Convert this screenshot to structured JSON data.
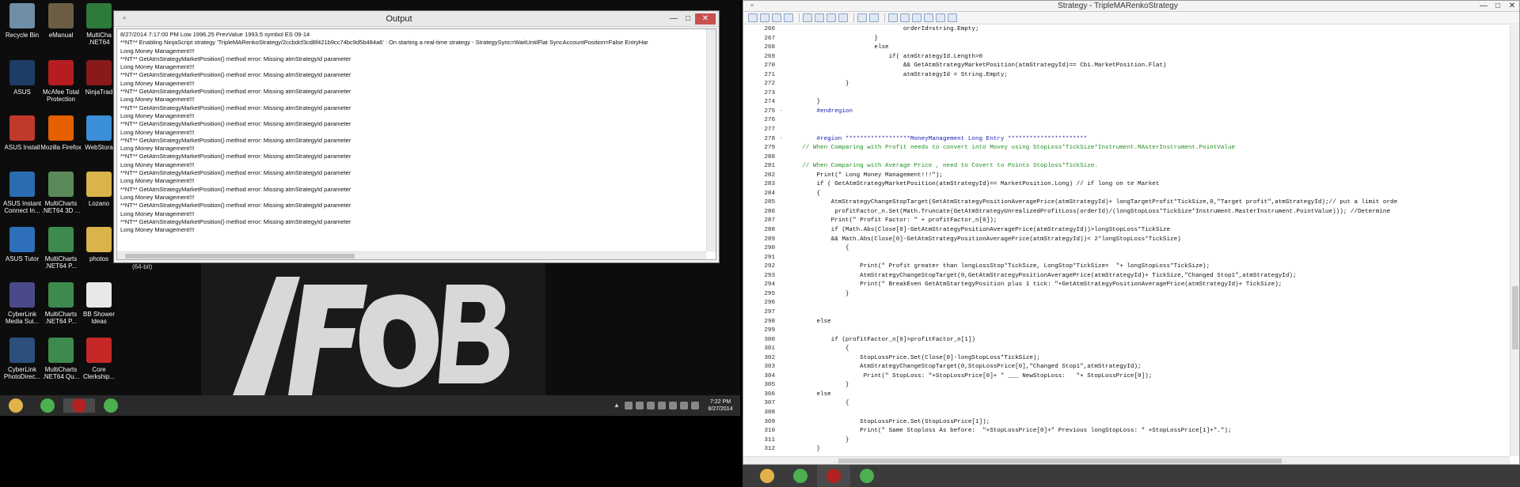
{
  "desktop": {
    "icons": [
      {
        "label": "Recycle Bin",
        "icon": "recycle-bin-icon",
        "color": "#6f8ea8"
      },
      {
        "label": "eManual",
        "icon": "emanual-icon",
        "color": "#6b5e44"
      },
      {
        "label": "MultiCha .NET64",
        "icon": "multicharts-icon",
        "color": "#2d7a3a"
      },
      {
        "label": "ASUS",
        "icon": "asus-icon",
        "color": "#1d3c66"
      },
      {
        "label": "McAfee Total Protection",
        "icon": "mcafee-icon",
        "color": "#b51d20"
      },
      {
        "label": "NinjaTrad",
        "icon": "ninjatrader-icon",
        "color": "#8a1a1a"
      },
      {
        "label": "ASUS Install",
        "icon": "asus-install-icon",
        "color": "#c0392b"
      },
      {
        "label": "Mozilla Firefox",
        "icon": "firefox-icon",
        "color": "#e66000"
      },
      {
        "label": "WebStora",
        "icon": "webstorage-icon",
        "color": "#3b8fd6"
      },
      {
        "label": "ASUS Instant Connect In...",
        "icon": "asus-instant-connect-icon",
        "color": "#2b6cb0"
      },
      {
        "label": "MultiCharts .NET64 3D ...",
        "icon": "multicharts-3d-icon",
        "color": "#5a8a5a"
      },
      {
        "label": "Lozano",
        "icon": "folder-icon",
        "color": "#d9b44a"
      },
      {
        "label": "ASUS Tutor",
        "icon": "asus-tutor-icon",
        "color": "#2d6fb8"
      },
      {
        "label": "MultiCharts .NET64 P...",
        "icon": "multicharts-p-icon",
        "color": "#3d8a4d"
      },
      {
        "label": "photos",
        "icon": "folder-icon",
        "color": "#d9b44a"
      },
      {
        "label": "CyberLink Media Sui...",
        "icon": "cyberlink-icon",
        "color": "#4a4a8a"
      },
      {
        "label": "MultiCharts .NET64 P...",
        "icon": "multicharts-p-icon",
        "color": "#3d8a4d"
      },
      {
        "label": "BB Shower Ideas",
        "icon": "document-icon",
        "color": "#e8e8e8"
      },
      {
        "label": "CyberLink PhotoDirec...",
        "icon": "photodirector-icon",
        "color": "#2c4f7c"
      },
      {
        "label": "MultiCharts .NET64 Qu...",
        "icon": "multicharts-q-icon",
        "color": "#3d8a4d"
      },
      {
        "label": "Core Clerkship...",
        "icon": "pdf-icon",
        "color": "#c62828"
      }
    ],
    "bit_label": "(64-bit)"
  },
  "output_window": {
    "title": "Output",
    "lines": [
      "8/27/2014 7:17:00 PM Low 1996.25 PrevValue 1993.5 symbol ES 09-14",
      "**NT** Enabling NinjaScript strategy 'TripleMARenkoStrategy/2ccbdcf3cd8f421b9cc74bc9d5b484a6' : On starting a real-time strategy - StrategySync=WaitUntilFlat SyncAccountPosition=False EntryHar",
      "Long Money Management!!!",
      "**NT** GetAtmStrategyMarketPosition() method error: Missing atmStrategyId parameter",
      "Long Money Management!!!",
      "**NT** GetAtmStrategyMarketPosition() method error: Missing atmStrategyId parameter",
      "Long Money Management!!!",
      "**NT** GetAtmStrategyMarketPosition() method error: Missing atmStrategyId parameter",
      "Long Money Management!!!",
      "**NT** GetAtmStrategyMarketPosition() method error: Missing atmStrategyId parameter",
      "Long Money Management!!!",
      "**NT** GetAtmStrategyMarketPosition() method error: Missing atmStrategyId parameter",
      "Long Money Management!!!",
      "**NT** GetAtmStrategyMarketPosition() method error: Missing atmStrategyId parameter",
      "Long Money Management!!!",
      "**NT** GetAtmStrategyMarketPosition() method error: Missing atmStrategyId parameter",
      "Long Money Management!!!",
      "**NT** GetAtmStrategyMarketPosition() method error: Missing atmStrategyId parameter",
      "Long Money Management!!!",
      "**NT** GetAtmStrategyMarketPosition() method error: Missing atmStrategyId parameter",
      "Long Money Management!!!",
      "**NT** GetAtmStrategyMarketPosition() method error: Missing atmStrategyId parameter",
      "Long Money Management!!!",
      "**NT** GetAtmStrategyMarketPosition() method error: Missing atmStrategyId parameter",
      "Long Money Management!!!"
    ]
  },
  "left_taskbar": {
    "apps": [
      {
        "icon": "file-explorer-icon",
        "color": "#e0b34a",
        "active": false
      },
      {
        "icon": "chrome-icon",
        "color": "#4caf50",
        "active": false
      },
      {
        "icon": "ninjatrader-icon",
        "color": "#b22222",
        "active": true
      },
      {
        "icon": "chrome-icon",
        "color": "#4caf50",
        "active": false
      }
    ],
    "time": "7:22 PM",
    "date": "8/27/2014"
  },
  "editor": {
    "title": "Strategy - TripleMARenkoStrategy",
    "lines": [
      {
        "n": "266",
        "fold": "",
        "text": "                                orderId=string.Empty;",
        "kind": "code"
      },
      {
        "n": "267",
        "fold": "",
        "text": "                        }",
        "kind": "code"
      },
      {
        "n": "268",
        "fold": "",
        "text": "                        else",
        "kind": "code"
      },
      {
        "n": "269",
        "fold": "",
        "text": "                            if( atmStrategyId.Length>0",
        "kind": "code"
      },
      {
        "n": "270",
        "fold": "",
        "text": "                                && GetAtmStrategyMarketPosition(atmStrategyId)== Cbi.MarketPosition.Flat)",
        "kind": "code"
      },
      {
        "n": "271",
        "fold": "",
        "text": "                                atmStrategyId = String.Empty;",
        "kind": "code"
      },
      {
        "n": "272",
        "fold": "",
        "text": "                }",
        "kind": "code"
      },
      {
        "n": "273",
        "fold": "",
        "text": "",
        "kind": "code"
      },
      {
        "n": "274",
        "fold": "",
        "text": "        }",
        "kind": "code"
      },
      {
        "n": "275",
        "fold": "-",
        "text": "        #endregion",
        "kind": "region"
      },
      {
        "n": "276",
        "fold": "",
        "text": "",
        "kind": "code"
      },
      {
        "n": "277",
        "fold": "",
        "text": "",
        "kind": "code"
      },
      {
        "n": "278",
        "fold": "-",
        "text": "        #region ******************MoneyManagement Long Entry **********************",
        "kind": "region"
      },
      {
        "n": "279",
        "fold": "",
        "text": "    // When Comparing with Profit needs to convert into Movey using StopLoss*TickSize*Instrument.MAsterInstrument.PointValue",
        "kind": "comment"
      },
      {
        "n": "280",
        "fold": "",
        "text": "",
        "kind": "code"
      },
      {
        "n": "281",
        "fold": "",
        "text": "    // When Comparing with Average Price , need to Covert to Points Stoploss*TickSize.",
        "kind": "comment"
      },
      {
        "n": "282",
        "fold": "",
        "text": "        Print(\" Long Money Management!!!\");",
        "kind": "code"
      },
      {
        "n": "283",
        "fold": "",
        "text": "        if ( GetAtmStrategyMarketPosition(atmStrategyId)== MarketPosition.Long) // if long on te Market",
        "kind": "code"
      },
      {
        "n": "284",
        "fold": "",
        "text": "        {",
        "kind": "code"
      },
      {
        "n": "285",
        "fold": "",
        "text": "            AtmStrategyChangeStopTarget(GetAtmStrategyPositionAveragePrice(atmStrategyId)+ longTargetProfit*TickSize,0,\"Target profit\",atmStrategyId);// put a limit orde",
        "kind": "code"
      },
      {
        "n": "286",
        "fold": "",
        "text": "             profitFactor_n.Set(Math.Truncate(GetAtmStrategyUnrealizedProfitLoss(orderId)/(longStopLoss*TickSize*Instrument.MasterInstrument.PointValue))); //Determine",
        "kind": "code"
      },
      {
        "n": "287",
        "fold": "",
        "text": "            Print(\" Profit Factor: \" + profitFactor_n[0]);",
        "kind": "code"
      },
      {
        "n": "288",
        "fold": "",
        "text": "            if (Math.Abs(Close[0]-GetAtmStrategyPositionAveragePrice(atmStrategyId))>longStopLoss*TickSize",
        "kind": "code"
      },
      {
        "n": "289",
        "fold": "",
        "text": "            && Math.Abs(Close[0]-GetAtmStrategyPositionAveragePrice(atmStrategyId))< 2*longStopLoss*TickSize)",
        "kind": "code"
      },
      {
        "n": "290",
        "fold": "",
        "text": "                {",
        "kind": "code"
      },
      {
        "n": "291",
        "fold": "",
        "text": "",
        "kind": "code"
      },
      {
        "n": "292",
        "fold": "",
        "text": "                    Print(\" Profit greater than longLossStop*TickSize, LongStop*TickSize=  \"+ longStopLoss*TickSize);",
        "kind": "code"
      },
      {
        "n": "293",
        "fold": "",
        "text": "                    AtmStrategyChangeStopTarget(0,GetAtmStrategyPositionAveragePrice(atmStrategyId)+ TickSize,\"Changed Stop1\",atmStrategyId);",
        "kind": "code"
      },
      {
        "n": "294",
        "fold": "",
        "text": "                    Print(\" BreakEven GetAtmStartegyPosition plus 1 tick: \"+GetAtmStrategyPositionAveragePrice(atmStrategyId)+ TickSize);",
        "kind": "code"
      },
      {
        "n": "295",
        "fold": "",
        "text": "                }",
        "kind": "code"
      },
      {
        "n": "296",
        "fold": "",
        "text": "",
        "kind": "code"
      },
      {
        "n": "297",
        "fold": "",
        "text": "",
        "kind": "code"
      },
      {
        "n": "298",
        "fold": "",
        "text": "        else",
        "kind": "code"
      },
      {
        "n": "299",
        "fold": "",
        "text": "",
        "kind": "code"
      },
      {
        "n": "300",
        "fold": "",
        "text": "            if (profitFactor_n[0]>profitFactor_n[1])",
        "kind": "code"
      },
      {
        "n": "301",
        "fold": "",
        "text": "                {",
        "kind": "code"
      },
      {
        "n": "302",
        "fold": "",
        "text": "                    StopLossPrice.Set(Close[0]-longStopLoss*TickSize);",
        "kind": "code"
      },
      {
        "n": "303",
        "fold": "",
        "text": "                    AtmStrategyChangeStopTarget(0,StopLossPrice[0],\"Changed Stop1\",atmStrategyId);",
        "kind": "code"
      },
      {
        "n": "304",
        "fold": "",
        "text": "                     Print(\" StopLoss: \"+StopLossPrice[0]+ \" ___ NewStopLoss:   \"+ StopLossPrice[0]);",
        "kind": "code"
      },
      {
        "n": "305",
        "fold": "",
        "text": "                }",
        "kind": "code"
      },
      {
        "n": "306",
        "fold": "",
        "text": "        else",
        "kind": "code"
      },
      {
        "n": "307",
        "fold": "",
        "text": "                {",
        "kind": "code"
      },
      {
        "n": "308",
        "fold": "",
        "text": "",
        "kind": "code"
      },
      {
        "n": "309",
        "fold": "",
        "text": "                    StopLossPrice.Set(StopLossPrice[1]);",
        "kind": "code"
      },
      {
        "n": "310",
        "fold": "",
        "text": "                    Print(\" Same Stoploss As before:  \"+StopLossPrice[0]+\" Previous longStopLoss: \" +StopLossPrice[1]+\".\");",
        "kind": "code"
      },
      {
        "n": "311",
        "fold": "",
        "text": "                }",
        "kind": "code"
      },
      {
        "n": "312",
        "fold": "",
        "text": "        }",
        "kind": "code"
      }
    ]
  },
  "right_taskbar": {
    "apps": [
      {
        "icon": "file-explorer-icon",
        "color": "#e0b34a",
        "active": false
      },
      {
        "icon": "chrome-icon",
        "color": "#4caf50",
        "active": false
      },
      {
        "icon": "ninjatrader-icon",
        "color": "#b22222",
        "active": true
      },
      {
        "icon": "chrome-icon",
        "color": "#4caf50",
        "active": false
      }
    ]
  }
}
